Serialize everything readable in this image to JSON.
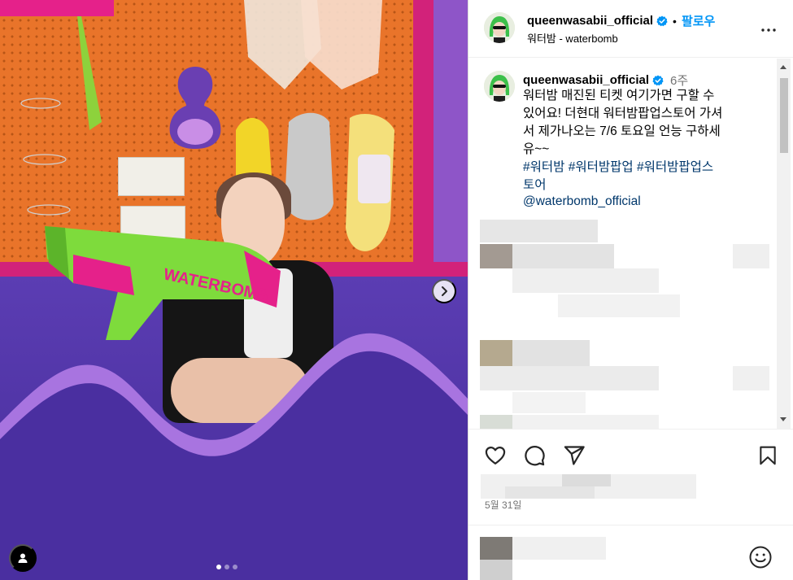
{
  "post": {
    "username": "queenwasabii_official",
    "follow_label": "팔로우",
    "separator": "•",
    "location": "워터밤 - waterbomb",
    "time_ago": "6주",
    "caption": "워터밤 매진된 티켓 여기가면 구할 수\n있어요! 더현대 워터밤팝업스토어 가셔\n서 제가나오는 7/6 토요일 언능 구하세\n유~~",
    "hashtags": [
      "#워터밤",
      "#워터밤팝업",
      "#워터밤팝업스",
      "토어"
    ],
    "mention": "@waterbomb_official",
    "date": "5월 31일",
    "carousel": {
      "total": 3,
      "active": 1
    }
  },
  "product_text": "WATERBOMB",
  "icons": {
    "verified": "verified-badge-icon",
    "more": "more-options-icon",
    "like": "heart-icon",
    "comment": "comment-bubble-icon",
    "share": "share-paper-plane-icon",
    "save": "bookmark-icon",
    "next": "chevron-right-icon",
    "tag": "user-tag-icon",
    "emoji": "emoji-smiley-icon"
  },
  "colors": {
    "accent": "#0095f6",
    "link": "#00376b",
    "muted": "#737373",
    "verified": "#0095f6"
  }
}
